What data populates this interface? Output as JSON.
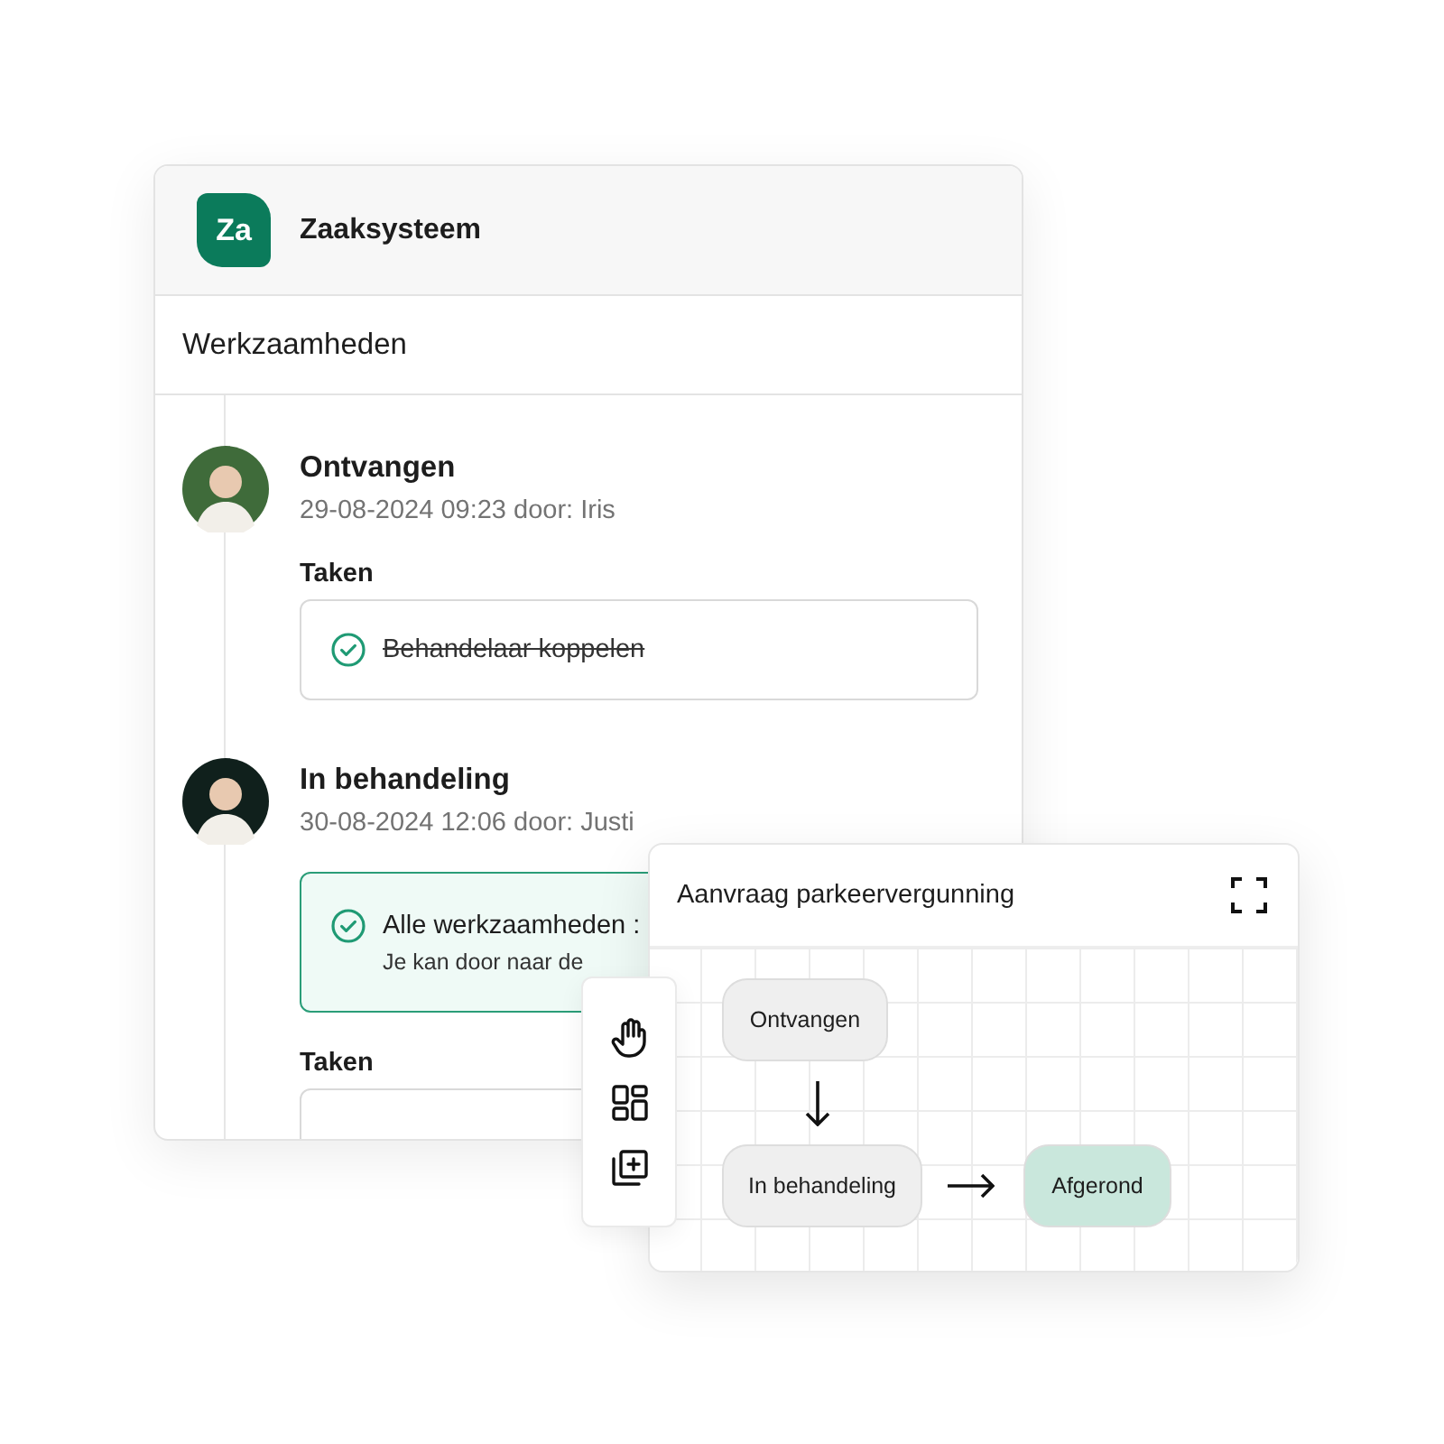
{
  "app": {
    "logo": "Za",
    "title": "Zaaksysteem"
  },
  "section": {
    "title": "Werkzaamheden"
  },
  "timeline": [
    {
      "title": "Ontvangen",
      "meta": "29-08-2024 09:23 door: Iris",
      "tasks_label": "Taken",
      "tasks": [
        {
          "label": "Behandelaar koppelen",
          "done": true
        }
      ]
    },
    {
      "title": "In behandeling",
      "meta": "30-08-2024 12:06 door: Justi",
      "alert": {
        "title": "Alle werkzaamheden :",
        "text": "Je kan door naar de"
      },
      "tasks_label": "Taken"
    }
  ],
  "flow": {
    "title": "Aanvraag parkeervergunning",
    "tools": [
      {
        "kind": "hand"
      },
      {
        "kind": "layout"
      },
      {
        "kind": "add"
      }
    ],
    "nodes": [
      {
        "label": "Ontvangen",
        "color": "#efefef"
      },
      {
        "label": "In behandeling",
        "color": "#efefef"
      },
      {
        "label": "Afgerond",
        "color": "#c9e7dc"
      }
    ],
    "arrows": [
      {
        "kind": "down"
      },
      {
        "kind": "right"
      }
    ]
  }
}
